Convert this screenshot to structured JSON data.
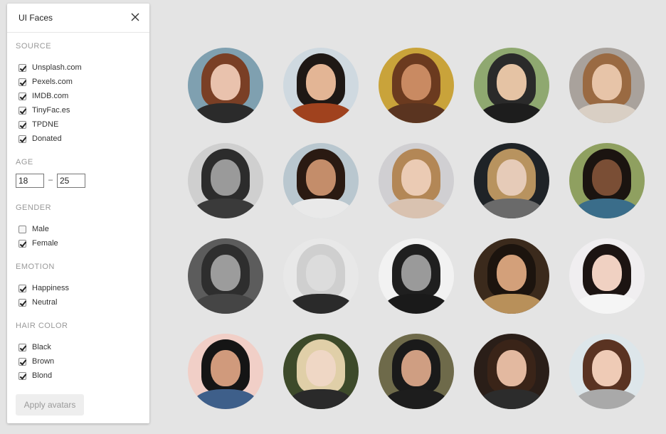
{
  "panel": {
    "title": "UI Faces",
    "sections": {
      "source": {
        "label": "SOURCE",
        "options": [
          {
            "label": "Unsplash.com",
            "checked": true
          },
          {
            "label": "Pexels.com",
            "checked": true
          },
          {
            "label": "IMDB.com",
            "checked": true
          },
          {
            "label": "TinyFac.es",
            "checked": true
          },
          {
            "label": "TPDNE",
            "checked": true
          },
          {
            "label": "Donated",
            "checked": true
          }
        ]
      },
      "age": {
        "label": "AGE",
        "min": "18",
        "separator": "–",
        "max": "25"
      },
      "gender": {
        "label": "GENDER",
        "options": [
          {
            "label": "Male",
            "checked": false
          },
          {
            "label": "Female",
            "checked": true
          }
        ]
      },
      "emotion": {
        "label": "EMOTION",
        "options": [
          {
            "label": "Happiness",
            "checked": true
          },
          {
            "label": "Neutral",
            "checked": true
          }
        ]
      },
      "hair_color": {
        "label": "HAIR COLOR",
        "options": [
          {
            "label": "Black",
            "checked": true
          },
          {
            "label": "Brown",
            "checked": true
          },
          {
            "label": "Blond",
            "checked": true
          }
        ]
      }
    },
    "apply_label": "Apply avatars"
  },
  "avatars": [
    {
      "bg": "#7fa0b0",
      "hair": "#7a3f25",
      "skin": "#e9c2ad",
      "body": "#2b2b2b"
    },
    {
      "bg": "#cfd9e0",
      "hair": "#1e1815",
      "skin": "#e3b595",
      "body": "#a0421e"
    },
    {
      "bg": "#c9a33a",
      "hair": "#6b3a1f",
      "skin": "#c98a62",
      "body": "#5a3420"
    },
    {
      "bg": "#8fa870",
      "hair": "#2a2a2a",
      "skin": "#e5c3a4",
      "body": "#1d1d1d"
    },
    {
      "bg": "#a9a29c",
      "hair": "#9a6a42",
      "skin": "#e7c4a8",
      "body": "#d9cfc4"
    },
    {
      "bg": "#cfcfcf",
      "hair": "#2c2c2c",
      "skin": "#9a9a9a",
      "body": "#3a3a3a"
    },
    {
      "bg": "#b9c7cf",
      "hair": "#2a1a12",
      "skin": "#c48d6a",
      "body": "#e9e9e9"
    },
    {
      "bg": "#d0cfd2",
      "hair": "#b38756",
      "skin": "#ebcbb4",
      "body": "#d9c2b0"
    },
    {
      "bg": "#1f2327",
      "hair": "#b8935f",
      "skin": "#e6cbb8",
      "body": "#6a6a6a"
    },
    {
      "bg": "#8fa060",
      "hair": "#1b1410",
      "skin": "#7a4e35",
      "body": "#3a6d8a"
    },
    {
      "bg": "#5c5c5c",
      "hair": "#2e2e2e",
      "skin": "#9c9c9c",
      "body": "#454545"
    },
    {
      "bg": "#e8e8e8",
      "hair": "#cfcfcf",
      "skin": "#dcdcdc",
      "body": "#2a2a2a"
    },
    {
      "bg": "#f2f2f2",
      "hair": "#1f1f1f",
      "skin": "#9a9a9a",
      "body": "#1a1a1a"
    },
    {
      "bg": "#3b2a1c",
      "hair": "#1c140e",
      "skin": "#d3a07a",
      "body": "#b8905a"
    },
    {
      "bg": "#f0eef0",
      "hair": "#1c1412",
      "skin": "#f0d1c2",
      "body": "#f5f5f5"
    },
    {
      "bg": "#f1cfc7",
      "hair": "#151515",
      "skin": "#d09a7c",
      "body": "#3e5f8a"
    },
    {
      "bg": "#3d4a2a",
      "hair": "#e0cfa8",
      "skin": "#efd7c5",
      "body": "#2a2a2a"
    },
    {
      "bg": "#6e6a4a",
      "hair": "#1a1a1a",
      "skin": "#cf9e82",
      "body": "#1d1d1d"
    },
    {
      "bg": "#2a1e18",
      "hair": "#3a2418",
      "skin": "#e3b9a0",
      "body": "#2c2c2c"
    },
    {
      "bg": "#dde6ea",
      "hair": "#5a3322",
      "skin": "#efcbb6",
      "body": "#a9a9a9"
    }
  ]
}
